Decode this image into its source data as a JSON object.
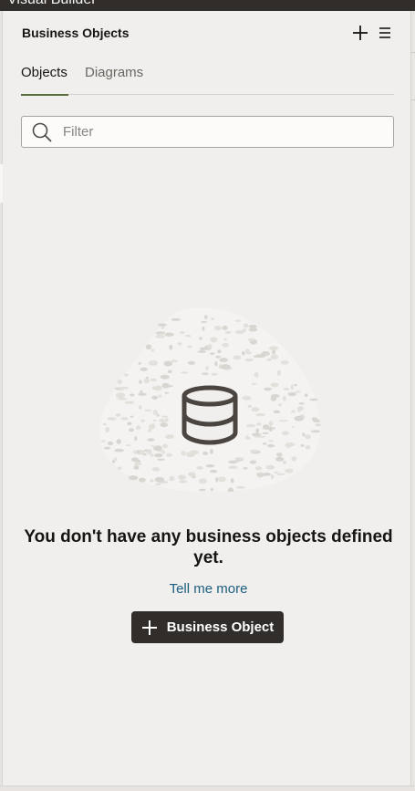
{
  "app": {
    "title": "Visual Builder"
  },
  "panel": {
    "title": "Business Objects",
    "add_icon": "plus-icon",
    "menu_icon": "hamburger-menu-icon"
  },
  "tabs": [
    {
      "label": "Objects",
      "active": true
    },
    {
      "label": "Diagrams",
      "active": false
    }
  ],
  "search": {
    "placeholder": "Filter",
    "value": "",
    "icon": "search-icon"
  },
  "empty_state": {
    "icon": "database-icon",
    "message": "You don't have any business objects defined yet.",
    "link": "Tell me more",
    "button_label": "Business Object",
    "button_icon": "plus-icon"
  },
  "colors": {
    "background": "#f1efed",
    "titlebar": "#312d2a",
    "tab_underline": "#5a6e3b",
    "link": "#1b5e80",
    "primary_button": "#312d2a"
  }
}
